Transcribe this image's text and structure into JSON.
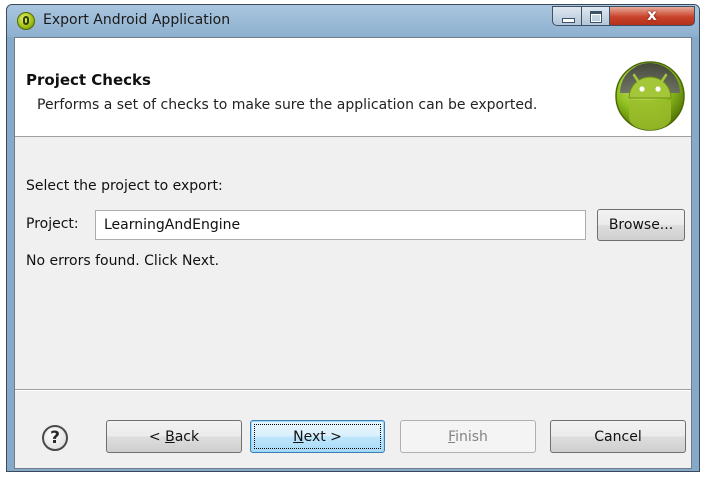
{
  "window": {
    "title": "Export Android Application",
    "close_glyph": "x"
  },
  "header": {
    "title": "Project Checks",
    "description": "Performs a set of checks to make sure the application can be exported.",
    "logo_icon": "android-logo-icon"
  },
  "form": {
    "select_label": "Select the project to export:",
    "project_label": "Project:",
    "project_value": "LearningAndEngine",
    "browse_label": "Browse...",
    "status_text": "No errors found. Click Next."
  },
  "footer": {
    "help_glyph": "?",
    "back": {
      "prefix": "< ",
      "mnemonic": "B",
      "rest": "ack"
    },
    "next": {
      "mnemonic": "N",
      "rest": "ext >"
    },
    "finish": {
      "mnemonic": "F",
      "rest": "inish"
    },
    "cancel_label": "Cancel"
  },
  "colors": {
    "title_bar": "#8db0cf",
    "close_button": "#c8432a",
    "android_green": "#a4c639"
  }
}
